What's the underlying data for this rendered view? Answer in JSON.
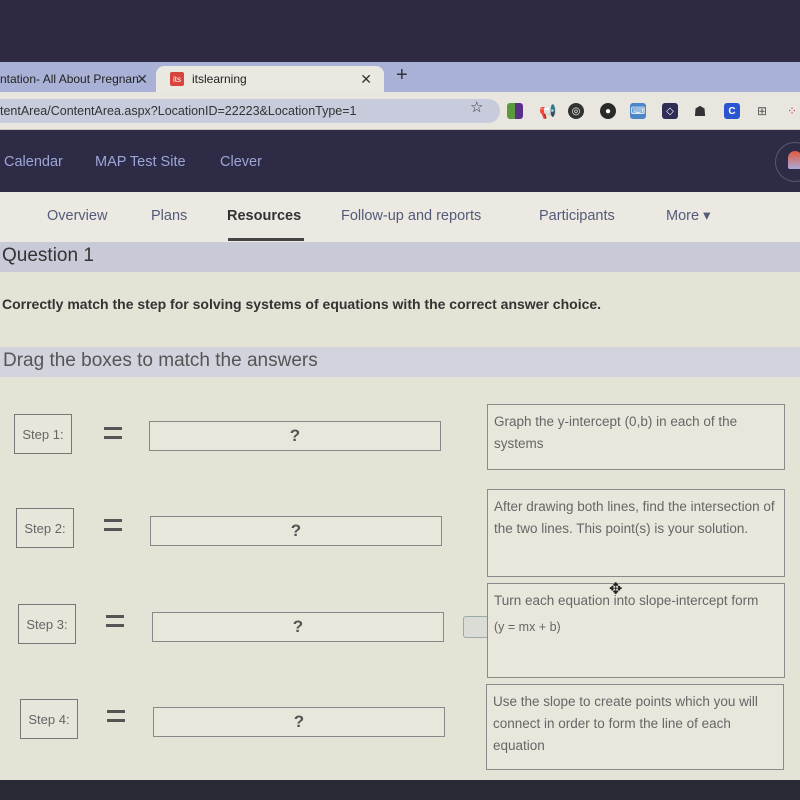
{
  "browser": {
    "tabs": [
      {
        "label": "ntation- All About Pregnan",
        "active": false
      },
      {
        "label": "itslearning",
        "favicon": "its",
        "active": true
      }
    ],
    "new_tab": "+",
    "url": "tentArea/ContentArea.aspx?LocationID=22223&LocationType=1",
    "extensions": [
      "color-bars-ext",
      "megaphone-ext",
      "target-ext",
      "pin-ext",
      "keyboard-ext",
      "square-ext",
      "bag-ext",
      "c-ext",
      "grid-ext",
      "dots-ext"
    ]
  },
  "site_nav": {
    "links": [
      "Calendar",
      "MAP Test Site",
      "Clever"
    ]
  },
  "course_nav": {
    "items": [
      "Overview",
      "Plans",
      "Resources",
      "Follow-up and reports",
      "Participants",
      "More ▾"
    ],
    "active": "Resources"
  },
  "question": {
    "title": "Question 1",
    "instruction": "Correctly match the step for solving systems of equations with the correct answer choice.",
    "drag_header": "Drag the boxes to match the answers",
    "steps": [
      {
        "label": "Step 1:",
        "placeholder": "?"
      },
      {
        "label": "Step 2:",
        "placeholder": "?"
      },
      {
        "label": "Step 3:",
        "placeholder": "?"
      },
      {
        "label": "Step 4:",
        "placeholder": "?"
      }
    ],
    "answers": [
      {
        "text": "Graph the y-intercept  (0,b) in each of the systems"
      },
      {
        "text": "After drawing both lines, find the intersection of the two lines. This point(s) is your solution."
      },
      {
        "text": "Turn each equation into slope-intercept form",
        "subtext": "(y = mx + b)"
      },
      {
        "text": "Use the slope to create points which you will connect in order to form the line of each equation"
      }
    ]
  }
}
